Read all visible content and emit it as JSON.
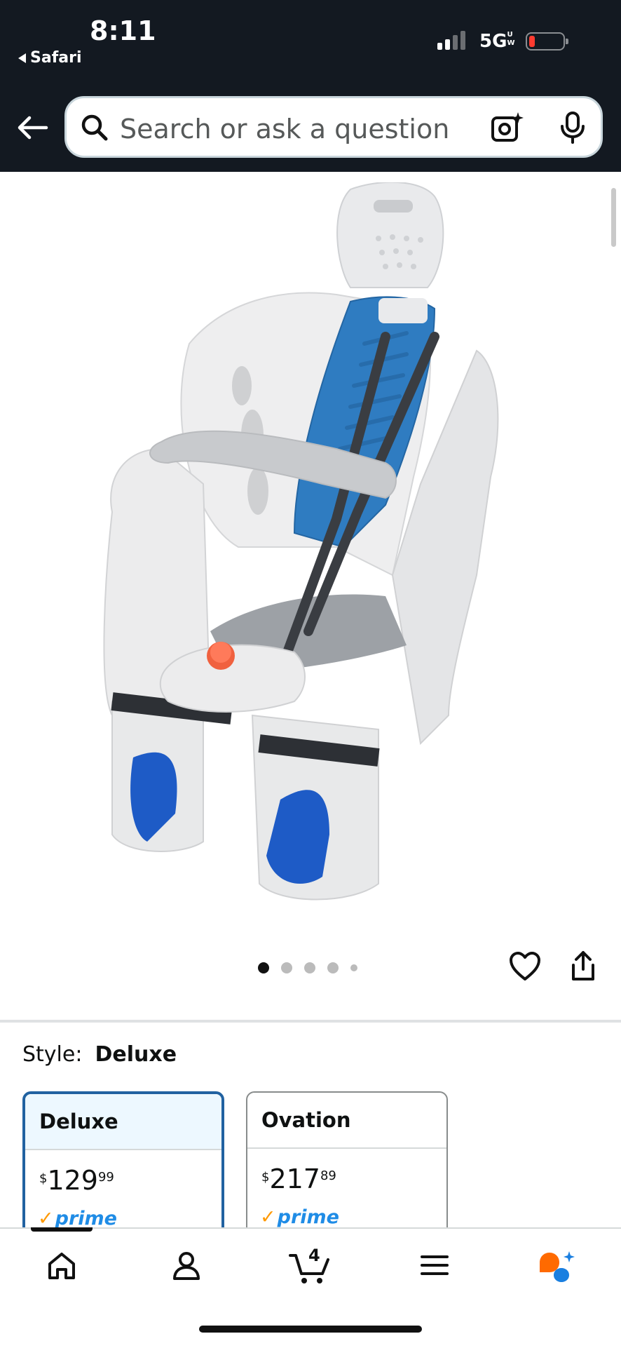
{
  "status_bar": {
    "time": "8:11",
    "back_app": "Safari",
    "network": "5G",
    "network_suffix": "UW"
  },
  "search": {
    "placeholder": "Search or ask a question"
  },
  "icons": {
    "back": "left-arrow-icon",
    "search": "magnifier-icon",
    "camera": "camera-sparkle-icon",
    "mic": "microphone-icon",
    "heart": "heart-outline-icon",
    "share": "share-icon",
    "home": "home-icon",
    "account": "person-icon",
    "cart": "cart-icon",
    "menu": "hamburger-icon",
    "rufus": "rufus-chat-icon"
  },
  "gallery": {
    "image_alt": "Child bicycle seat in white with blue padding and dark straps",
    "dots": [
      true,
      false,
      false,
      false,
      false
    ]
  },
  "style": {
    "label": "Style:",
    "value": "Deluxe",
    "options": [
      {
        "name": "Deluxe",
        "currency": "$",
        "whole": "129",
        "fraction": "99",
        "badge": "prime"
      },
      {
        "name": "Ovation",
        "currency": "$",
        "whole": "217",
        "fraction": "89",
        "badge": "prime"
      }
    ]
  },
  "bottom_nav": {
    "cart_count": "4"
  },
  "colors": {
    "topbar": "#131921",
    "selected_border": "#2162a1",
    "prime_blue": "#1f8ce6",
    "prime_check": "#ff9900",
    "seat_blue": "#2f7cc1"
  }
}
